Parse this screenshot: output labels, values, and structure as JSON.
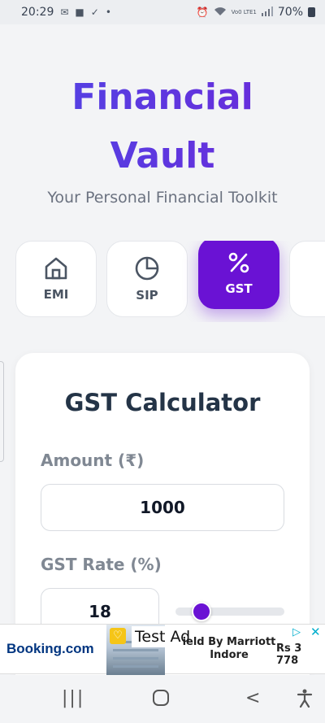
{
  "status_bar": {
    "time": "20:29",
    "left_icons": [
      "notification-icon",
      "video-icon",
      "check-icon",
      "dot-icon"
    ],
    "network": "Vo0 LTE1",
    "battery": "70%"
  },
  "header": {
    "title_line1": "Financial",
    "title_line2": "Vault",
    "subtitle": "Your Personal Financial Toolkit",
    "accent_color": "#5b3de8"
  },
  "tabs": [
    {
      "label": "EMI",
      "icon": "home-icon",
      "active": false
    },
    {
      "label": "SIP",
      "icon": "pie-chart-icon",
      "active": false
    },
    {
      "label": "GST",
      "icon": "percent-icon",
      "active": true
    },
    {
      "label": "",
      "icon": "more-icon",
      "active": false
    }
  ],
  "calculator": {
    "title": "GST Calculator",
    "amount_label": "Amount (₹)",
    "amount_value": "1000",
    "rate_label": "GST Rate (%)",
    "rate_value": "18",
    "rate_slider_fraction": 0.18,
    "active_color": "#6a12d4"
  },
  "ad": {
    "brand": "Booking.com",
    "label": "Test Ad",
    "text": "ield By Marriott Indore",
    "price": "Rs 3 778"
  },
  "nav": {
    "recent": "|||",
    "home": "○",
    "back": "<"
  }
}
